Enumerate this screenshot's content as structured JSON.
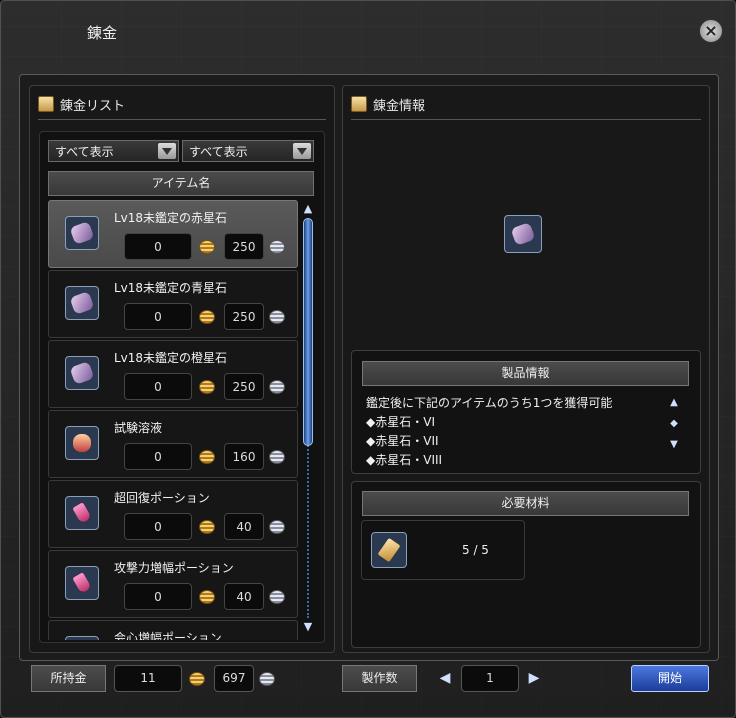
{
  "window": {
    "title": "錬金"
  },
  "left_panel": {
    "header": "錬金リスト",
    "filter1": "すべて表示",
    "filter2": "すべて表示",
    "column_header": "アイテム名",
    "items": [
      {
        "name": "Lv18未鑑定の赤星石",
        "gold": "0",
        "silver": "250",
        "icon": "star-stone-icon"
      },
      {
        "name": "Lv18未鑑定の青星石",
        "gold": "0",
        "silver": "250",
        "icon": "star-stone-icon"
      },
      {
        "name": "Lv18未鑑定の橙星石",
        "gold": "0",
        "silver": "250",
        "icon": "star-stone-icon"
      },
      {
        "name": "試験溶液",
        "gold": "0",
        "silver": "160",
        "icon": "flask-icon"
      },
      {
        "name": "超回復ポーション",
        "gold": "0",
        "silver": "40",
        "icon": "potion-icon"
      },
      {
        "name": "攻撃力増幅ポーション",
        "gold": "0",
        "silver": "40",
        "icon": "potion-icon"
      },
      {
        "name": "会心増幅ポーション",
        "gold": "",
        "silver": "",
        "icon": "potion-icon"
      }
    ]
  },
  "right_panel": {
    "header": "錬金情報",
    "product_info_label": "製品情報",
    "product_lines": [
      "鑑定後に下記のアイテムのうち1つを獲得可能",
      "◆赤星石・VI",
      "◆赤星石・VII",
      "◆赤星石・VIII"
    ],
    "materials_label": "必要材料",
    "material_count": "5 / 5"
  },
  "footer": {
    "money_label": "所持金",
    "gold": "11",
    "silver": "697",
    "craft_count_label": "製作数",
    "craft_count": "1",
    "start_label": "開始"
  },
  "colors": {
    "accent": "#2c54c0",
    "panel": "#181818",
    "border": "#5a5a5a"
  }
}
